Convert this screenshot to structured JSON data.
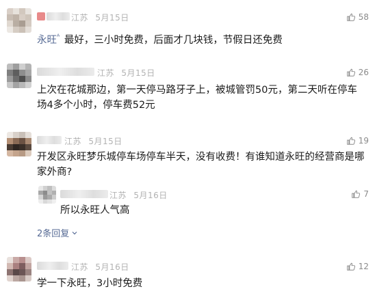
{
  "comments": [
    {
      "location": "江苏",
      "date": "5月15日",
      "likes": "58",
      "reply_to": "永旺",
      "text": "最好，三小时免费，后面才几块钱，节假日还免费"
    },
    {
      "location": "江苏",
      "date": "5月15日",
      "likes": "26",
      "text": "上次在花城那边，第一天停马路牙子上，被城管罚50元，第二天听在停车场4多个小时，停车费52元"
    },
    {
      "location": "江苏",
      "date": "5月15日",
      "likes": "19",
      "text": "开发区永旺梦乐城停车场停车半天，没有收费！有谁知道永旺的经营商是哪家外商?",
      "reply": {
        "location": "江苏",
        "date": "5月16日",
        "likes": "7",
        "text": "所以永旺人气高"
      },
      "replies_toggle": "2条回复"
    },
    {
      "location": "江苏",
      "date": "5月16日",
      "likes": "12",
      "text": "学一下永旺，3小时免费"
    }
  ]
}
